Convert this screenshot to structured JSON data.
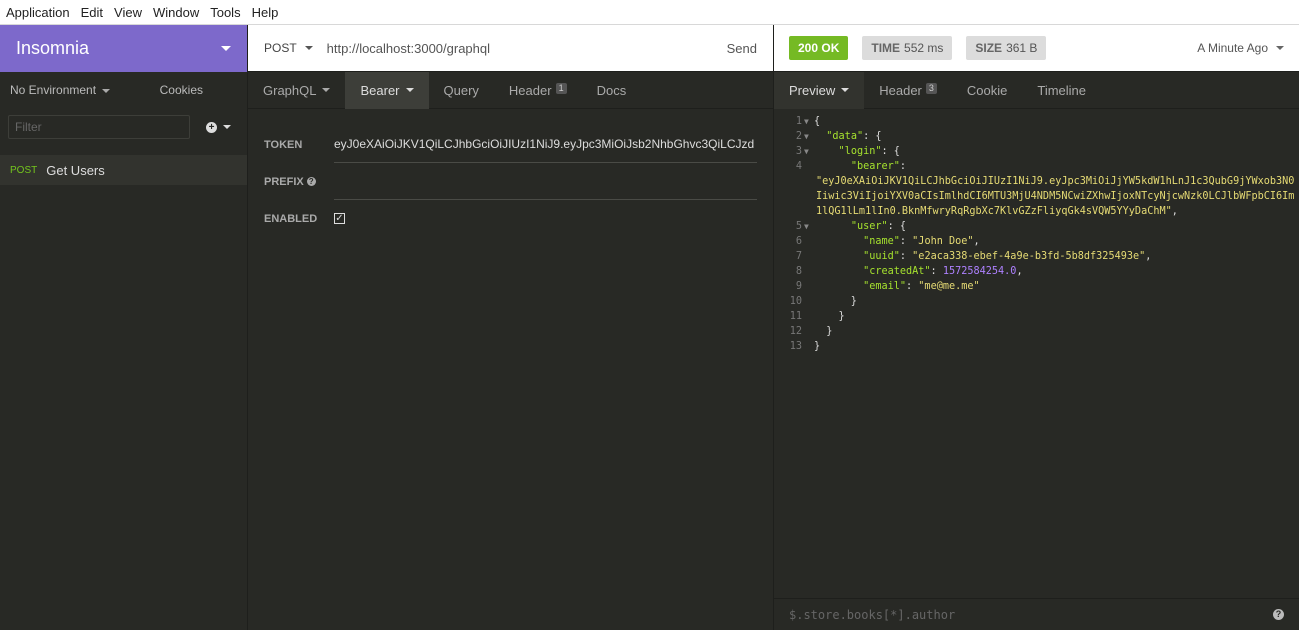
{
  "menubar": [
    "Application",
    "Edit",
    "View",
    "Window",
    "Tools",
    "Help"
  ],
  "sidebar": {
    "workspace": "Insomnia",
    "environment": "No Environment",
    "cookies": "Cookies",
    "filter_placeholder": "Filter",
    "requests": [
      {
        "method": "POST",
        "name": "Get Users"
      }
    ]
  },
  "request": {
    "method": "POST",
    "url": "http://localhost:3000/graphql",
    "send": "Send",
    "tabs": [
      {
        "label": "GraphQL",
        "caret": true
      },
      {
        "label": "Bearer",
        "caret": true,
        "active": true
      },
      {
        "label": "Query"
      },
      {
        "label": "Header",
        "badge": "1"
      },
      {
        "label": "Docs"
      }
    ],
    "auth": {
      "token_label": "TOKEN",
      "token_value": "eyJ0eXAiOiJKV1QiLCJhbGciOiJIUzI1NiJ9.eyJpc3MiOiJsb2NhbGhvc3QiLCJzd",
      "prefix_label": "PREFIX",
      "enabled_label": "ENABLED",
      "enabled": true
    }
  },
  "response": {
    "status": "200 OK",
    "time_label": "TIME",
    "time_value": "552 ms",
    "size_label": "SIZE",
    "size_value": "361 B",
    "ago": "A Minute Ago",
    "tabs": [
      {
        "label": "Preview",
        "caret": true,
        "active": true
      },
      {
        "label": "Header",
        "badge": "3"
      },
      {
        "label": "Cookie"
      },
      {
        "label": "Timeline"
      }
    ],
    "filter_placeholder": "$.store.books[*].author",
    "help_icon": "?",
    "lines": [
      {
        "n": "1",
        "fold": true,
        "parts": [
          [
            "p",
            "{"
          ]
        ]
      },
      {
        "n": "2",
        "fold": true,
        "parts": [
          [
            "p",
            "  "
          ],
          [
            "k",
            "\"data\""
          ],
          [
            "p",
            ": {"
          ]
        ]
      },
      {
        "n": "3",
        "fold": true,
        "parts": [
          [
            "p",
            "    "
          ],
          [
            "k",
            "\"login\""
          ],
          [
            "p",
            ": {"
          ]
        ]
      },
      {
        "n": "4",
        "fold": false,
        "parts": [
          [
            "p",
            "      "
          ],
          [
            "k",
            "\"bearer\""
          ],
          [
            "p",
            ":"
          ]
        ]
      },
      {
        "n": "",
        "fold": false,
        "wrap": true,
        "parts": [
          [
            "s",
            "\"eyJ0eXAiOiJKV1QiLCJhbGciOiJIUzI1NiJ9.eyJpc3MiOiJjYW5kdW1hLnJ1c3QubG9jYWxob3N0Iiwic3ViIjoiYXV0aCIsImlhdCI6MTU3MjU4NDM5NCwiZXhwIjoxNTcyNjcwNzk0LCJlbWFpbCI6Im1lQG1lLm1lIn0.BknMfwryRqRgbXc7KlvGZzFliyqGk4sVQW5YYyDaChM\""
          ],
          [
            "p",
            ","
          ]
        ]
      },
      {
        "n": "5",
        "fold": true,
        "parts": [
          [
            "p",
            "      "
          ],
          [
            "k",
            "\"user\""
          ],
          [
            "p",
            ": {"
          ]
        ]
      },
      {
        "n": "6",
        "fold": false,
        "parts": [
          [
            "p",
            "        "
          ],
          [
            "k",
            "\"name\""
          ],
          [
            "p",
            ": "
          ],
          [
            "s",
            "\"John Doe\""
          ],
          [
            "p",
            ","
          ]
        ]
      },
      {
        "n": "7",
        "fold": false,
        "parts": [
          [
            "p",
            "        "
          ],
          [
            "k",
            "\"uuid\""
          ],
          [
            "p",
            ": "
          ],
          [
            "s",
            "\"e2aca338-ebef-4a9e-b3fd-5b8df325493e\""
          ],
          [
            "p",
            ","
          ]
        ]
      },
      {
        "n": "8",
        "fold": false,
        "parts": [
          [
            "p",
            "        "
          ],
          [
            "k",
            "\"createdAt\""
          ],
          [
            "p",
            ": "
          ],
          [
            "n",
            "1572584254.0"
          ],
          [
            "p",
            ","
          ]
        ]
      },
      {
        "n": "9",
        "fold": false,
        "parts": [
          [
            "p",
            "        "
          ],
          [
            "k",
            "\"email\""
          ],
          [
            "p",
            ": "
          ],
          [
            "s",
            "\"me@me.me\""
          ]
        ]
      },
      {
        "n": "10",
        "fold": false,
        "parts": [
          [
            "p",
            "      }"
          ]
        ]
      },
      {
        "n": "11",
        "fold": false,
        "parts": [
          [
            "p",
            "    }"
          ]
        ]
      },
      {
        "n": "12",
        "fold": false,
        "parts": [
          [
            "p",
            "  }"
          ]
        ]
      },
      {
        "n": "13",
        "fold": false,
        "parts": [
          [
            "p",
            "}"
          ]
        ]
      }
    ]
  }
}
